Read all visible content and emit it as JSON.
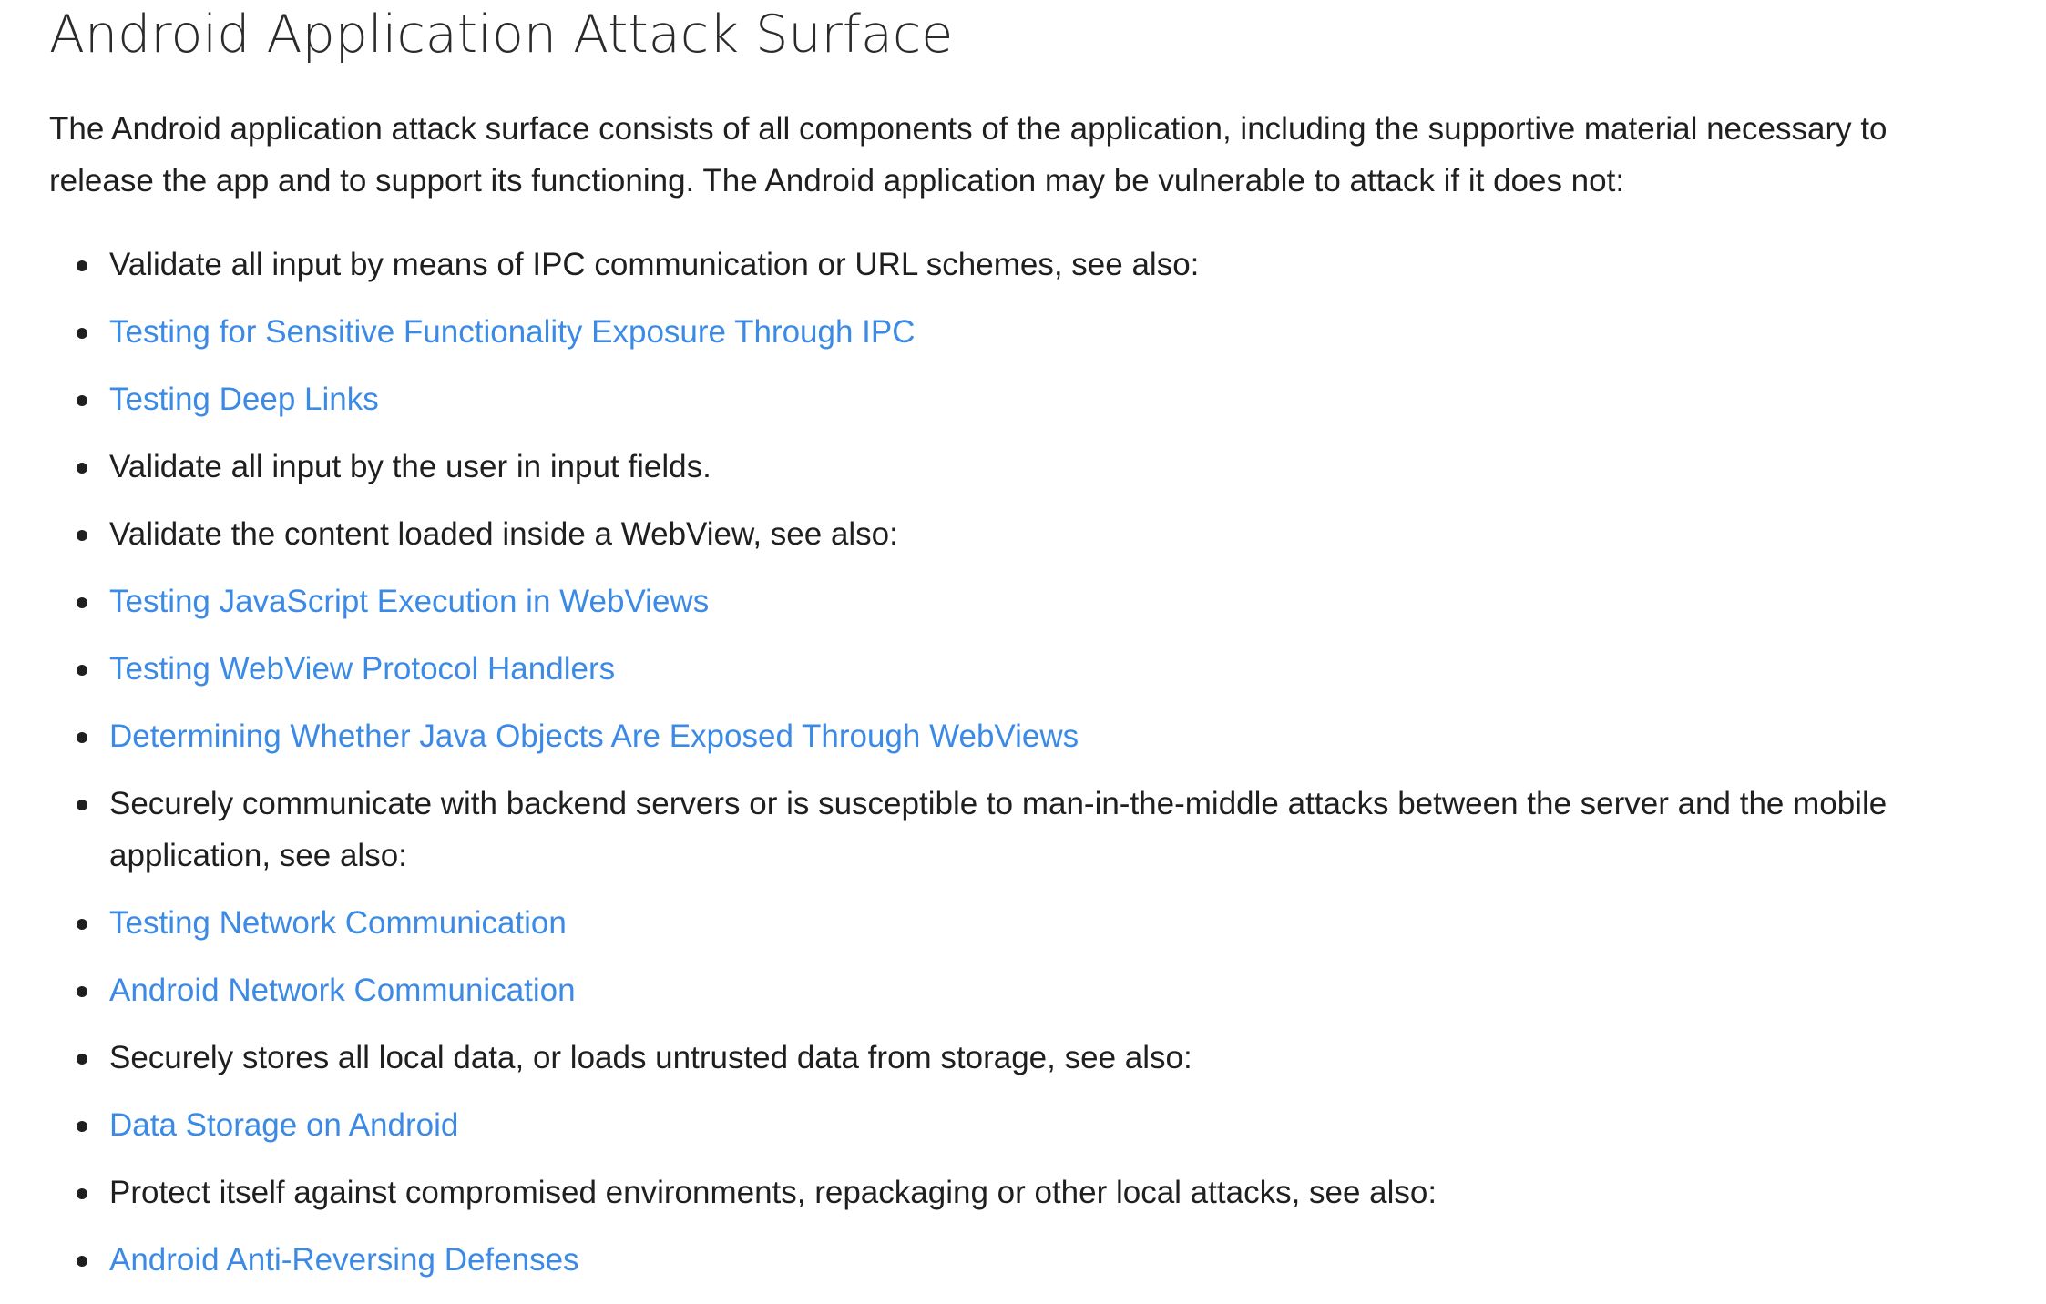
{
  "title": "Android Application Attack Surface",
  "intro": "The Android application attack surface consists of all components of the application, including the supportive material necessary to release the app and to support its functioning. The Android application may be vulnerable to attack if it does not:",
  "colors": {
    "text": "#1f1f1f",
    "link": "#3b8ae6",
    "background": "#ffffff"
  },
  "items": [
    {
      "text": "Validate all input by means of IPC communication or URL schemes, see also:",
      "is_link": false
    },
    {
      "text": "Testing for Sensitive Functionality Exposure Through IPC",
      "is_link": true
    },
    {
      "text": "Testing Deep Links",
      "is_link": true
    },
    {
      "text": "Validate all input by the user in input fields.",
      "is_link": false
    },
    {
      "text": "Validate the content loaded inside a WebView, see also:",
      "is_link": false
    },
    {
      "text": "Testing JavaScript Execution in WebViews",
      "is_link": true
    },
    {
      "text": "Testing WebView Protocol Handlers",
      "is_link": true
    },
    {
      "text": "Determining Whether Java Objects Are Exposed Through WebViews",
      "is_link": true
    },
    {
      "text": "Securely communicate with backend servers or is susceptible to man-in-the-middle attacks between the server and the mobile application, see also:",
      "is_link": false
    },
    {
      "text": "Testing Network Communication",
      "is_link": true
    },
    {
      "text": "Android Network Communication",
      "is_link": true
    },
    {
      "text": "Securely stores all local data, or loads untrusted data from storage, see also:",
      "is_link": false
    },
    {
      "text": "Data Storage on Android",
      "is_link": true
    },
    {
      "text": "Protect itself against compromised environments, repackaging or other local attacks, see also:",
      "is_link": false
    },
    {
      "text": "Android Anti-Reversing Defenses",
      "is_link": true
    }
  ]
}
